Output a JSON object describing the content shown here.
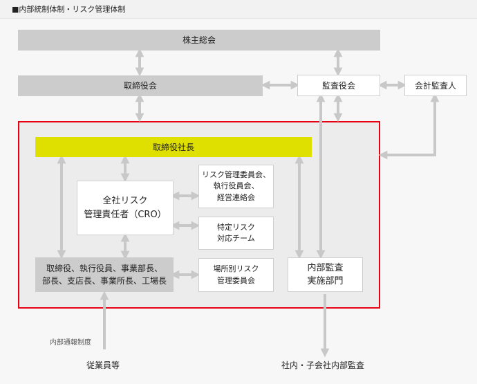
{
  "header": {
    "title": "■内部統制体制・リスク管理体制"
  },
  "nodes": {
    "shareholders": "株主総会",
    "board": "取締役会",
    "auditors": "監査役会",
    "accounting_auditor": "会計監査人",
    "president": "取締役社長",
    "cro": "全社リスク\n管理責任者（CRO）",
    "risk_committee": "リスク管理委員会、\n執行役員会、\n経営連絡会",
    "specific_risk": "特定リスク\n対応チーム",
    "site_risk": "場所別リスク\n管理委員会",
    "executives": "取締役、執行役員、事業部長、\n部長、支店長、事業所長、工場長",
    "internal_audit": "内部監査\n実施部門"
  },
  "labels": {
    "whistleblowing": "内部通報制度",
    "employees": "従業員等",
    "group_audit": "社内・子会社内部監査"
  },
  "colors": {
    "gray_box": "#cccccc",
    "lime_box": "#e0e000",
    "red_frame": "#e60012",
    "arrow": "#c8c8c8"
  }
}
